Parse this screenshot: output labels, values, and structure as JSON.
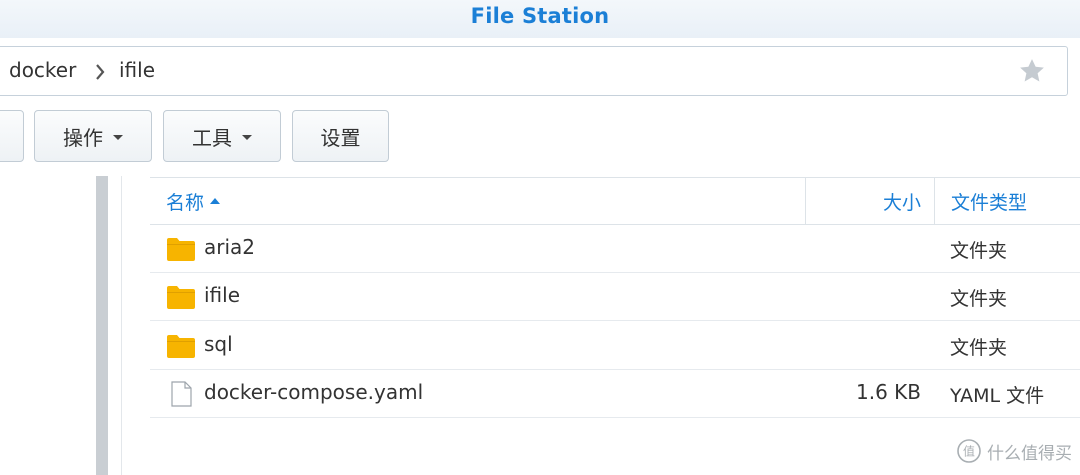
{
  "window": {
    "title": "File Station"
  },
  "path": {
    "segments": [
      "docker",
      "ifile"
    ]
  },
  "toolbar": {
    "action_label": "操作",
    "tools_label": "工具",
    "settings_label": "设置"
  },
  "table": {
    "headers": {
      "name": "名称",
      "size": "大小",
      "type": "文件类型"
    },
    "sort": {
      "column": "name",
      "direction": "asc"
    },
    "rows": [
      {
        "icon": "folder-icon",
        "name": "aria2",
        "size": "",
        "type": "文件夹"
      },
      {
        "icon": "folder-icon",
        "name": "ifile",
        "size": "",
        "type": "文件夹"
      },
      {
        "icon": "folder-icon",
        "name": "sql",
        "size": "",
        "type": "文件夹"
      },
      {
        "icon": "file-icon",
        "name": "docker-compose.yaml",
        "size": "1.6 KB",
        "type": "YAML 文件"
      }
    ]
  },
  "watermark": {
    "text": "什么值得买"
  },
  "colors": {
    "accent": "#1b7fd6",
    "folder": "#f7b400",
    "border": "#c6d1db"
  }
}
